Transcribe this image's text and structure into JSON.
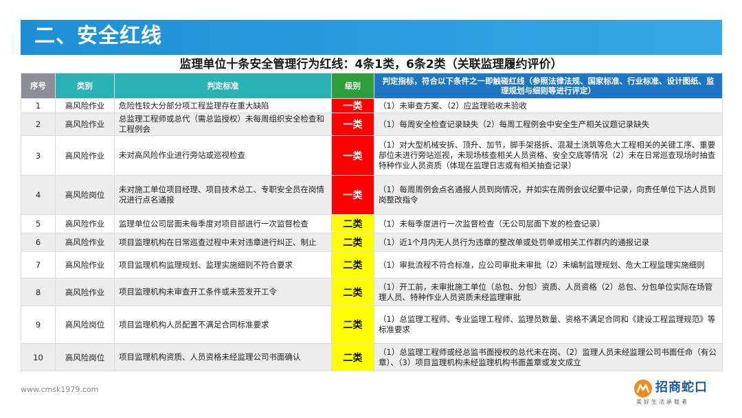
{
  "header": {
    "title": "二、安全红线"
  },
  "subtitle": "监理单位十条安全管理行为红线：4条1类，6条2类（关联监理履约评价）",
  "table": {
    "headers": {
      "seq": "序号",
      "category": "类别",
      "criteria": "判定标准",
      "level": "级别",
      "indicator": "判定指标，符合以下条件之一即触碰红线（参照法律法规、国家标准、行业标准、设计图纸、监理规划与细则等进行评定）"
    },
    "rows": [
      {
        "seq": "1",
        "category": "高风险作业",
        "criteria": "危险性较大分部分项工程监理存在重大缺陷",
        "level": "一类",
        "indicator": "（1）未审查方案、（2）应监理验收未验收"
      },
      {
        "seq": "2",
        "category": "高风险作业",
        "criteria": "总监理工程师或总代（需总监授权）未每周组织安全检查和工程例会",
        "level": "一类",
        "indicator": "（1）每周安全检查记录缺失（2）每周工程例会中安全生产相关议题记录缺失"
      },
      {
        "seq": "3",
        "category": "高风险作业",
        "criteria": "未对高风险作业进行旁站或巡视检查",
        "level": "一类",
        "indicator": "（1）对大型机械安拆、顶升、加节，脚手架搭拆、混凝土浇筑等危大工程相关的关键工序、重要部位未进行旁站巡视，未现场核查相关人员资格、安全交底等情况（2）未在日常巡查现场时抽查特种作业人员资质（体现在监理日志或有相关抽查记录）"
      },
      {
        "seq": "4",
        "category": "高风险岗位",
        "criteria": "未对施工单位项目经理、项目技术总工、专职安全员在岗情况进行点名通报",
        "level": "一类",
        "indicator": "（1）每周周例会点名通报人员到岗情况，并如实在周例会议纪要中记录，向责任单位下达人员到岗整改指令"
      },
      {
        "seq": "5",
        "category": "高风险作业",
        "criteria": "监理单位公司层面未每季度对项目部进行一次监督检查",
        "level": "二类",
        "indicator": "（1）未每季度进行一次监督检查（无公司层面下发的检查记录）"
      },
      {
        "seq": "6",
        "category": "高风险作业",
        "criteria": "项目监理机构在日常巡查过程中未对违章进行纠正、制止",
        "level": "二类",
        "indicator": "（1）近1个月内无人员行为违章的整改单或处罚单或相关工作群内的通报记录"
      },
      {
        "seq": "7",
        "category": "高风险作业",
        "criteria": "项目监理机构监理规划、监理实施细则不符合要求",
        "level": "二类",
        "indicator": "（1）审批流程不符合标准，应公司审批未审批（2）未编制监理规划、危大工程监理实施细则"
      },
      {
        "seq": "8",
        "category": "高风险作业",
        "criteria": "项目监理机构未审查开工条件或未签发开工令",
        "level": "二类",
        "indicator": "（1）开工前，未审批施工单位（总包、分包）资质、人员资格（2）总包、分包单位实际在场管理人员、特种作业人员资质未经监理审批"
      },
      {
        "seq": "9",
        "category": "高风险岗位",
        "criteria": "项目监理机构人员配置不满足合同标准要求",
        "level": "二类",
        "indicator": "（1）总监理工程师、专业监理工程师、监理员数量、资格不满足合同和《建设工程监理规范》等标准要求"
      },
      {
        "seq": "10",
        "category": "高风险岗位",
        "criteria": "项目监理机构资质、人员资格未经监理公司书面确认",
        "level": "二类",
        "indicator": "（1）总监理工程师或经总监书面授权的总代未在岗、（2）监理人员未经监理公司书面任命（有公章）、（3）项目监理机构未经监理机构书面盖章或发文成立"
      }
    ]
  },
  "footer": {
    "url": "www.cmsk1979.com"
  },
  "logo": {
    "name": "招商蛇口",
    "slogan": "美好生活承载者"
  },
  "colors": {
    "header_blue": "#1d8fd6",
    "level_red": "#ff0000",
    "level_yellow": "#ffff00",
    "th_gray": "#8c8f94",
    "th_teal": "#2bb2b4",
    "th_green": "#2e9d3a",
    "th_blue": "#1d76c2",
    "logo_orange": "#f08c1e",
    "logo_blue": "#1d5aa8"
  },
  "icons": {
    "logo_mark": "cmsk-logo-icon"
  }
}
